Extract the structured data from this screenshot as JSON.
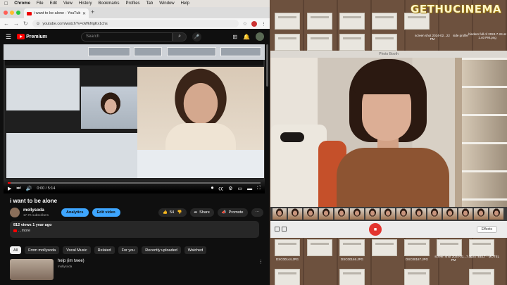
{
  "menubar": {
    "app": "Chrome",
    "items": [
      "File",
      "Edit",
      "View",
      "History",
      "Bookmarks",
      "Profiles",
      "Tab",
      "Window",
      "Help"
    ]
  },
  "browser": {
    "tab_title": "i want to be alone - YouTube",
    "url": "youtube.com/watch?v=oWkNgKx1chs"
  },
  "youtube": {
    "logo": "Premium",
    "search_placeholder": "Search",
    "video": {
      "time": "0:00 / 5:14",
      "progress_fraction": 0.01
    },
    "title": "i want to be alone",
    "channel": {
      "name": "mollysoda",
      "subscribers": "17.7K subscribers"
    },
    "buttons": {
      "analytics": "Analytics",
      "edit_video": "Edit video",
      "likes": "54",
      "share": "Share",
      "promote": "Promote"
    },
    "description": {
      "stats": "812 views  1 year ago",
      "more": "...more"
    },
    "chips": [
      "All",
      "From mollysoda",
      "Vocal Music",
      "Related",
      "For you",
      "Recently uploaded",
      "Watched"
    ],
    "recommended": {
      "title": "help (im twee)",
      "channel": "mollysoda"
    }
  },
  "desktop": {
    "watermark": "GETHUCINEMA",
    "labels": [
      "screen shot 2024-02...22 PM",
      "side profile",
      "binders full of 2024-7-24 at 1.40 PM.png",
      "DSC00144.JPG",
      "DSC00146.JPG",
      "DSC00167.JPG",
      "screen shot 2024-01...7.00 PM",
      "BUSTBELT - MOTEL"
    ]
  },
  "photobooth": {
    "title": "Photo Booth",
    "effects": "Effects"
  }
}
